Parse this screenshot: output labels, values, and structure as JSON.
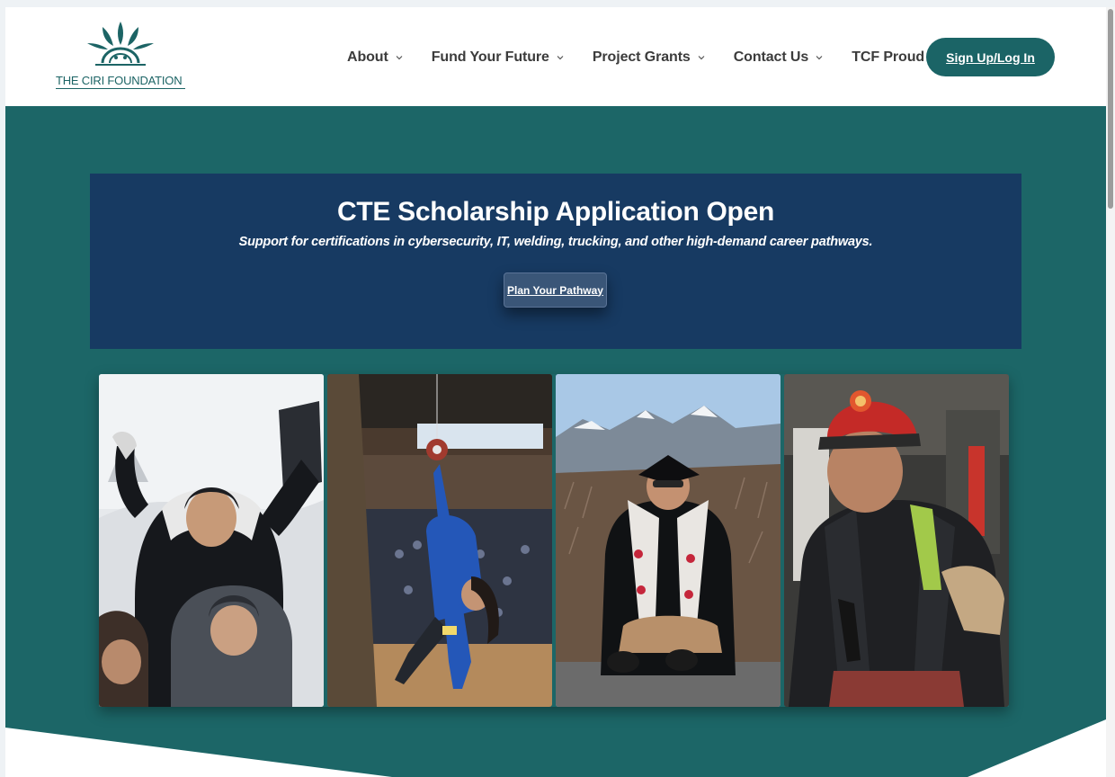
{
  "logo": {
    "text": "THE CIRI FOUNDATION"
  },
  "nav": {
    "items": [
      {
        "label": "About",
        "has_dropdown": true
      },
      {
        "label": "Fund Your Future",
        "has_dropdown": true
      },
      {
        "label": "Project Grants",
        "has_dropdown": true
      },
      {
        "label": "Contact Us",
        "has_dropdown": true
      },
      {
        "label": "TCF Proud",
        "has_dropdown": false
      }
    ],
    "signup_label": "Sign Up/Log In"
  },
  "banner": {
    "title": "CTE Scholarship Application Open",
    "subtitle": "Support for certifications in cybersecurity, IT, welding, trucking, and other high-demand career pathways.",
    "button_label": "Plan Your Pathway"
  },
  "photos": [
    {
      "icon": "photo-students-celebrating-snow"
    },
    {
      "icon": "photo-athlete-high-kick"
    },
    {
      "icon": "photo-graduate-mountains"
    },
    {
      "icon": "photo-firefighter-helmet"
    }
  ],
  "colors": {
    "brand_teal": "#1c6667",
    "banner_navy": "#173a62",
    "button_blue": "#3a5678",
    "signup_bg": "#1b6466"
  }
}
